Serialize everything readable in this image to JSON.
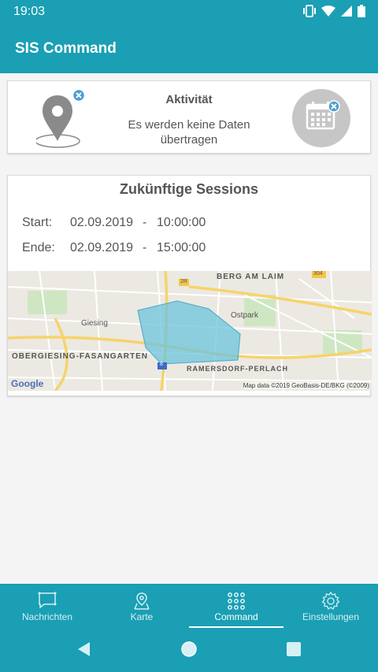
{
  "status": {
    "time": "19:03"
  },
  "app": {
    "title": "SIS Command"
  },
  "activity": {
    "title": "Aktivität",
    "message": "Es werden keine Daten übertragen"
  },
  "sessions": {
    "title": "Zukünftige Sessions",
    "start_label": "Start:",
    "start_date": "02.09.2019",
    "start_sep": "-",
    "start_time": "10:00:00",
    "end_label": "Ende:",
    "end_date": "02.09.2019",
    "end_sep": "-",
    "end_time": "15:00:00"
  },
  "map": {
    "labels": {
      "berg": "BERG AM LAIM",
      "giesing": "Giesing",
      "obergiesing": "OBERGIESING-FASANGARTEN",
      "ostpark": "Ostpark",
      "ramersdorf": "RAMERSDORF-PERLACH",
      "road304": "304",
      "road2r": "2R",
      "road8": "8"
    },
    "google": "Google",
    "attribution": "Map data ©2019 GeoBasis-DE/BKG (©2009)"
  },
  "nav": {
    "items": [
      {
        "label": "Nachrichten",
        "icon": "message-icon"
      },
      {
        "label": "Karte",
        "icon": "map-icon"
      },
      {
        "label": "Command",
        "icon": "command-icon"
      },
      {
        "label": "Einstellungen",
        "icon": "gear-icon"
      }
    ],
    "active": "Command"
  },
  "colors": {
    "primary": "#1a9fb4",
    "text": "#555555",
    "area": "#6cc3dc"
  }
}
